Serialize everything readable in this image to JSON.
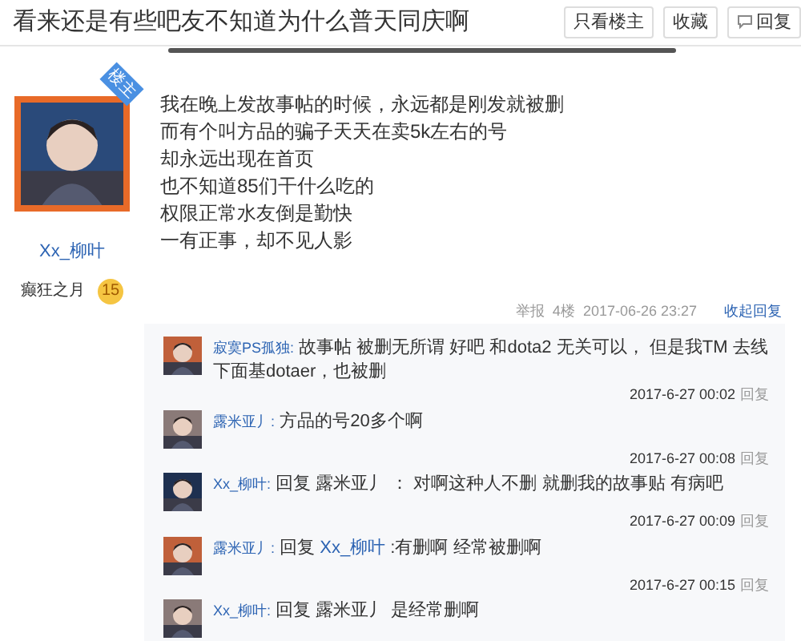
{
  "header": {
    "title": "看来还是有些吧友不知道为什么普天同庆啊",
    "buttons": [
      {
        "label": "只看楼主",
        "icon": false
      },
      {
        "label": "收藏",
        "icon": false
      },
      {
        "label": "回复",
        "icon": true
      }
    ]
  },
  "post": {
    "author": {
      "badge": "楼主",
      "name": "Xx_柳叶",
      "level_title": "癫狂之月",
      "level": "15"
    },
    "lines": [
      "我在晚上发故事帖的时候，永远都是刚发就被删",
      "而有个叫方品的骗子天天在卖5k左右的号",
      "却永远出现在首页",
      "也不知道85们干什么吃的",
      "权限正常水友倒是勤快",
      "一有正事，却不见人影"
    ],
    "footer": {
      "report": "举报",
      "floor": "4楼",
      "time": "2017-06-26 23:27",
      "collapse": "收起回复"
    },
    "replies": [
      {
        "user": "寂寞PS孤独:",
        "parts": [
          {
            "text": "故事帖 被删无所谓 好吧 和dota2 无关可以， 但是我TM 去线下面基dotaer，也被删",
            "link": false
          }
        ],
        "time": "2017-6-27 00:02",
        "action": "回复"
      },
      {
        "user": "露米亚丿:",
        "parts": [
          {
            "text": "方品的号20多个啊",
            "link": false
          }
        ],
        "time": "2017-6-27 00:08",
        "action": "回复"
      },
      {
        "user": "Xx_柳叶:",
        "parts": [
          {
            "text": "回复 露米亚丿 ： 对啊这种人不删 就删我的故事贴 有病吧",
            "link": false
          }
        ],
        "time": "2017-6-27 00:09",
        "action": "回复"
      },
      {
        "user": "露米亚丿:",
        "parts": [
          {
            "text": "回复",
            "link": false
          },
          {
            "text": "Xx_柳叶",
            "link": true
          },
          {
            "text": ":有删啊 经常被删啊",
            "link": false
          }
        ],
        "time": "2017-6-27 00:15",
        "action": "回复"
      },
      {
        "user": "Xx_柳叶:",
        "parts": [
          {
            "text": "回复 露米亚丿 是经常删啊",
            "link": false
          }
        ]
      }
    ]
  }
}
